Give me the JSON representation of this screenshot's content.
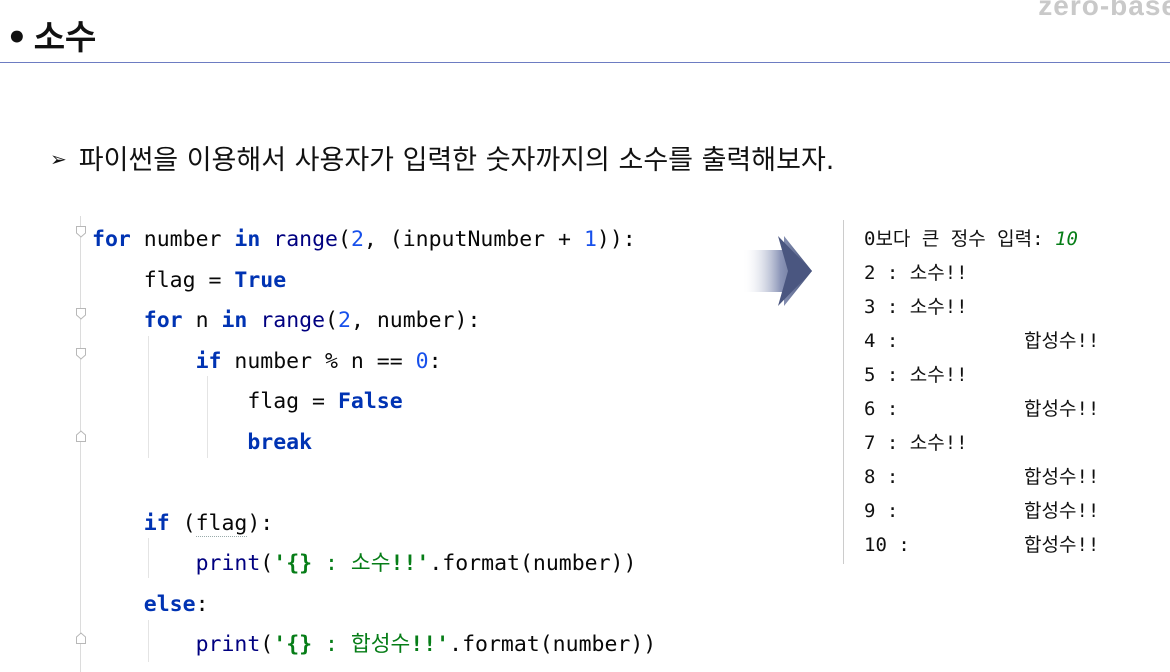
{
  "brand": "zero-base",
  "title": "소수",
  "subtitle": "파이썬을 이용해서 사용자가 입력한 숫자까지의 소수를 출력해보자.",
  "code": {
    "l1": {
      "kw_for": "for",
      "t1": " number ",
      "kw_in": "in",
      "sp": " ",
      "fn_range": "range",
      "t2": "(",
      "n1": "2",
      "t3": ", (inputNumber + ",
      "n2": "1",
      "t4": ")):"
    },
    "l2": {
      "t1": "    flag = ",
      "kw_true": "True"
    },
    "l3": {
      "indent": "    ",
      "kw_for": "for",
      "t1": " n ",
      "kw_in": "in",
      "sp": " ",
      "fn_range": "range",
      "t2": "(",
      "n1": "2",
      "t3": ", number):"
    },
    "l4": {
      "indent": "        ",
      "kw_if": "if",
      "t1": " number % n == ",
      "n1": "0",
      "t2": ":"
    },
    "l5": {
      "t1": "            flag = ",
      "kw_false": "False"
    },
    "l6": {
      "indent": "            ",
      "kw_break": "break"
    },
    "l7": {
      "indent": "    ",
      "kw_if": "if",
      "sp": " ",
      "t1": "(",
      "flag": "flag",
      "t2": "):"
    },
    "l8": {
      "indent": "        ",
      "fn_print": "print",
      "t1": "(",
      "q1": "'",
      "br": "{}",
      "s1": " : 소수",
      "ex": "!!",
      "q2": "'",
      "t2": ".format(number))"
    },
    "l9": {
      "indent": "    ",
      "kw_else": "else",
      "t1": ":"
    },
    "l10": {
      "indent": "        ",
      "fn_print": "print",
      "t1": "(",
      "q1": "'",
      "br": "{}",
      "s1": " : 합성수",
      "ex": "!!",
      "q2": "'",
      "t2": ".format(number))"
    }
  },
  "console": {
    "prompt": "0보다 큰 정수 입력: ",
    "input_value": "10",
    "rows": [
      {
        "num": "2 : ",
        "result": "소수!!",
        "composite": false
      },
      {
        "num": "3 : ",
        "result": "소수!!",
        "composite": false
      },
      {
        "num": "4 :",
        "result": "합성수!!",
        "composite": true
      },
      {
        "num": "5 : ",
        "result": "소수!!",
        "composite": false
      },
      {
        "num": "6 :",
        "result": "합성수!!",
        "composite": true
      },
      {
        "num": "7 : ",
        "result": "소수!!",
        "composite": false
      },
      {
        "num": "8 :",
        "result": "합성수!!",
        "composite": true
      },
      {
        "num": "9 :",
        "result": "합성수!!",
        "composite": true
      },
      {
        "num": "10 :",
        "result": "합성수!!",
        "composite": true
      }
    ]
  },
  "colors": {
    "accent_rule": "#6d7cc2",
    "keyword": "#0033b3",
    "string": "#067d17",
    "number": "#1750eb",
    "arrow": "#3d4a73"
  }
}
